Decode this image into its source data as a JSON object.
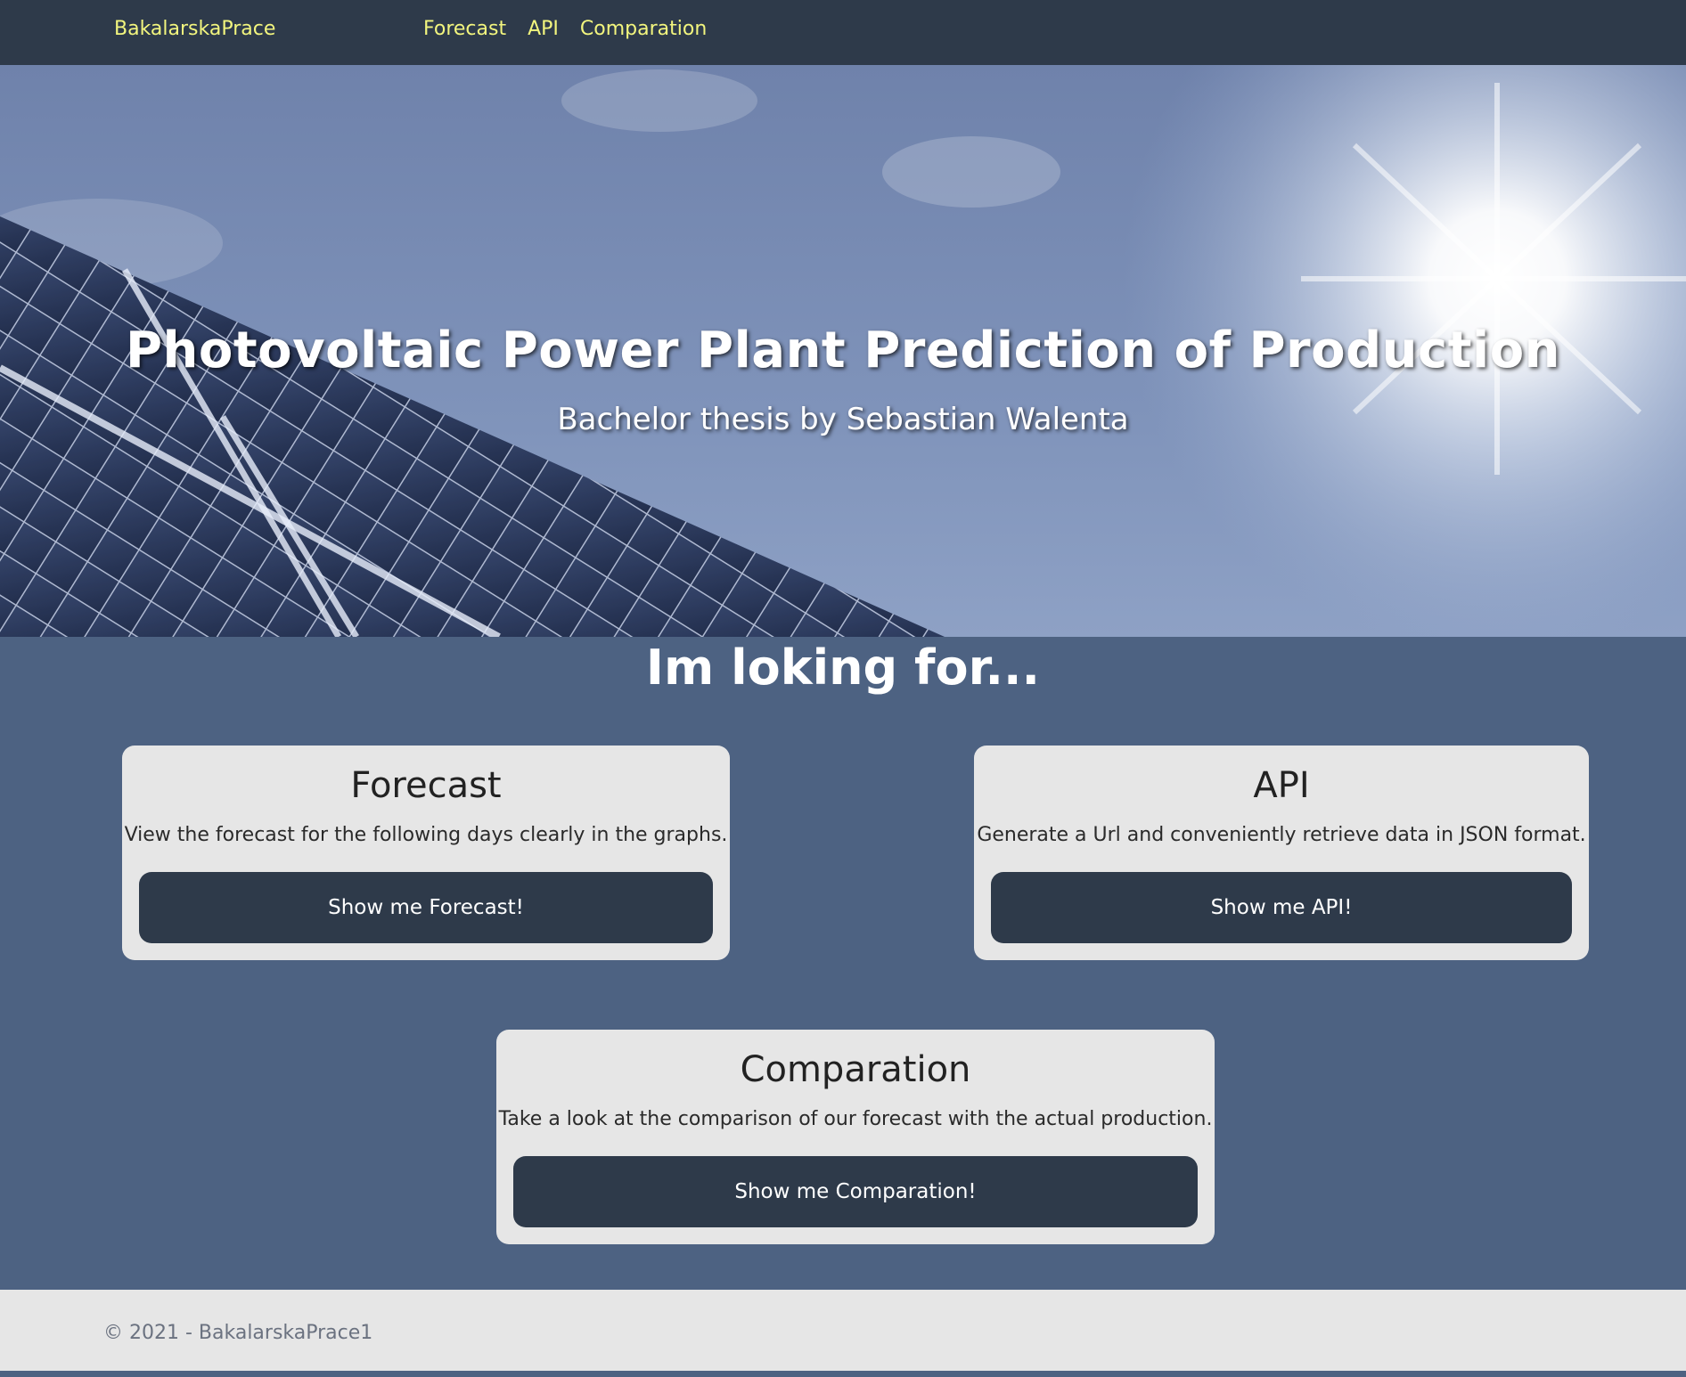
{
  "navbar": {
    "brand": "BakalarskaPrace",
    "links": [
      {
        "label": "Forecast"
      },
      {
        "label": "API"
      },
      {
        "label": "Comparation"
      }
    ]
  },
  "hero": {
    "title": "Photovoltaic Power Plant Prediction of Production",
    "subtitle": "Bachelor thesis by Sebastian Walenta"
  },
  "main": {
    "heading": "Im loking for...",
    "cards": [
      {
        "title": "Forecast",
        "text": "View the forecast for the following days clearly in the graphs.",
        "button": "Show me Forecast!"
      },
      {
        "title": "API",
        "text": "Generate a Url and conveniently retrieve data in JSON format.",
        "button": "Show me API!"
      },
      {
        "title": "Comparation",
        "text": "Take a look at the comparison of our forecast with the actual production.",
        "button": "Show me Comparation!"
      }
    ]
  },
  "footer": {
    "text": "© 2021 - BakalarskaPrace1"
  },
  "colors": {
    "navbar_bg": "#2e3a4a",
    "nav_link": "#f2f57e",
    "content_bg": "#4d6282",
    "card_bg": "#e6e6e6",
    "button_bg": "#2e3a4a"
  }
}
